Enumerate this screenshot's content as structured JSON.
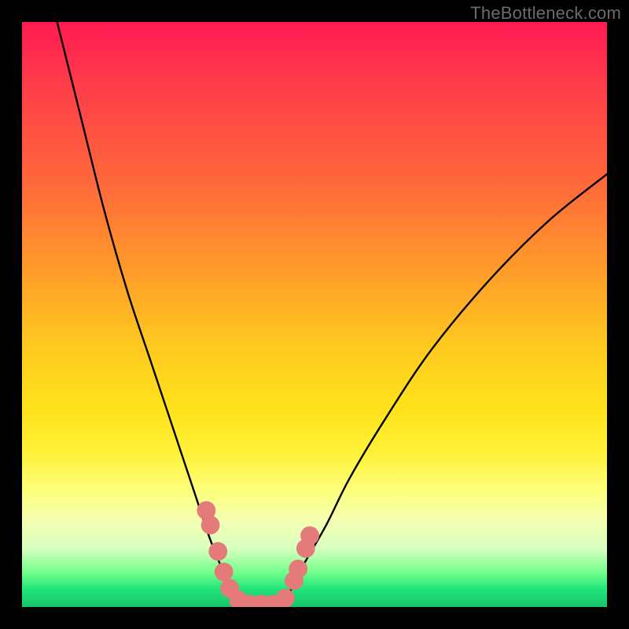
{
  "watermark": {
    "text": "TheBottleneck.com"
  },
  "chart_data": {
    "type": "line",
    "title": "",
    "xlabel": "",
    "ylabel": "",
    "xlim": [
      0,
      100
    ],
    "ylim": [
      0,
      100
    ],
    "grid": false,
    "legend": null,
    "gradient_stops": [
      {
        "pct": 0,
        "color": "#ff1a52"
      },
      {
        "pct": 28,
        "color": "#ff6a3a"
      },
      {
        "pct": 55,
        "color": "#ffc81f"
      },
      {
        "pct": 80,
        "color": "#fcff7a"
      },
      {
        "pct": 94,
        "color": "#76ff8c"
      },
      {
        "pct": 100,
        "color": "#17c46a"
      }
    ],
    "series": [
      {
        "name": "left-branch",
        "x": [
          6,
          10,
          14,
          18,
          22,
          26,
          30,
          32,
          34,
          36,
          38
        ],
        "y": [
          100,
          84,
          68,
          54,
          42,
          30,
          18,
          12,
          7,
          3,
          0
        ]
      },
      {
        "name": "right-branch",
        "x": [
          44,
          46,
          48,
          52,
          56,
          62,
          70,
          80,
          90,
          100
        ],
        "y": [
          0,
          3,
          7,
          14,
          22,
          32,
          44,
          56,
          66,
          74
        ]
      },
      {
        "name": "valley-floor",
        "x": [
          38,
          40,
          42,
          44
        ],
        "y": [
          0,
          0,
          0,
          0
        ]
      }
    ],
    "markers": [
      {
        "x": 31.5,
        "y": 16.5,
        "r": 1.6
      },
      {
        "x": 32.2,
        "y": 14.0,
        "r": 1.6
      },
      {
        "x": 33.5,
        "y": 9.5,
        "r": 1.6
      },
      {
        "x": 34.5,
        "y": 6.0,
        "r": 1.6
      },
      {
        "x": 35.5,
        "y": 3.2,
        "r": 1.6
      },
      {
        "x": 37.0,
        "y": 1.2,
        "r": 1.6
      },
      {
        "x": 39.0,
        "y": 0.5,
        "r": 1.6
      },
      {
        "x": 41.0,
        "y": 0.5,
        "r": 1.6
      },
      {
        "x": 43.0,
        "y": 0.5,
        "r": 1.6
      },
      {
        "x": 45.0,
        "y": 1.5,
        "r": 1.6
      },
      {
        "x": 46.5,
        "y": 4.5,
        "r": 1.6
      },
      {
        "x": 47.2,
        "y": 6.5,
        "r": 1.6
      },
      {
        "x": 48.5,
        "y": 10.0,
        "r": 1.6
      },
      {
        "x": 49.2,
        "y": 12.2,
        "r": 1.6
      }
    ],
    "marker_color": "#e47a7a"
  }
}
